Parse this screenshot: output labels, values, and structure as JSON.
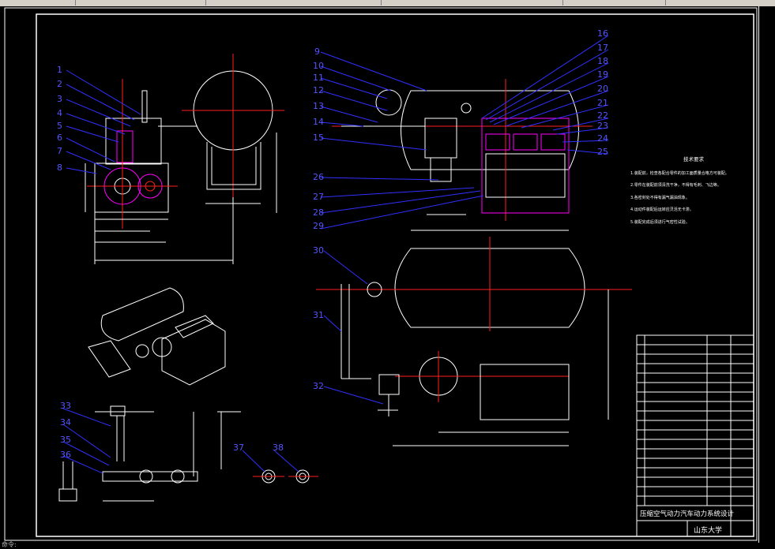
{
  "colors": {
    "background": "#000000",
    "frame": "#ffffff",
    "centerline": "#ff2020",
    "leader": "#3030ff",
    "part": "#ffffff",
    "highlight": "#ff00ff",
    "dimension": "#ffffff"
  },
  "balloons_left": [
    "1",
    "2",
    "3",
    "4",
    "5",
    "6",
    "7",
    "8"
  ],
  "balloons_right_top_left": [
    "9",
    "10",
    "11",
    "12",
    "13",
    "14",
    "15"
  ],
  "balloons_right_top_right": [
    "16",
    "17",
    "18",
    "19",
    "20",
    "21",
    "22",
    "23",
    "24",
    "25"
  ],
  "balloons_right_bottom_left": [
    "26",
    "27",
    "28",
    "29"
  ],
  "balloons_mid": [
    "30",
    "31",
    "32"
  ],
  "balloons_bottom_left": [
    "33",
    "34",
    "35",
    "36"
  ],
  "balloons_bottom_small": [
    "37",
    "38"
  ],
  "title_block": {
    "drawing_name": "压缩空气动力汽车动力系统设计",
    "school": "山东大学"
  },
  "tech_requirements": {
    "title": "技术要求",
    "items": [
      "1.装配前，检查各配合零件的加工面质量合格方可装配。",
      "2.零件在装配前须清洗干净，不得有毛刺、飞边等。",
      "3.各密封处不得有漏气漏油现象。",
      "4.运动件装配后运转应灵活无卡滞。",
      "5.装配完成后须进行气密性试验。"
    ]
  },
  "status_text": "命令:"
}
